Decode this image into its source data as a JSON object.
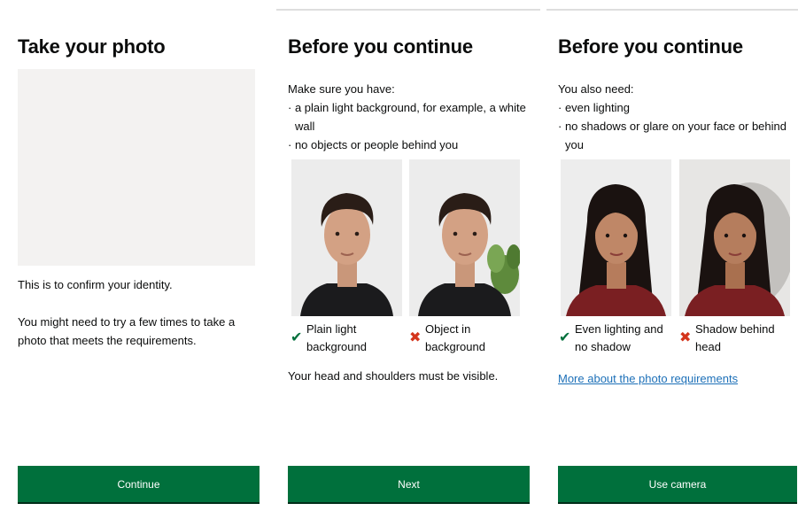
{
  "screens": [
    {
      "title": "Take your photo",
      "paragraphs": [
        "This is to confirm your identity.",
        "You might need to try a few times to take a photo that meets the requirements."
      ],
      "button": "Continue"
    },
    {
      "title": "Before you continue",
      "intro": "Make sure you have:",
      "bullets": [
        "· a plain light background, for example, a white wall",
        "· no objects or people behind you"
      ],
      "examples": [
        {
          "verdict": "tick",
          "caption": "Plain light background"
        },
        {
          "verdict": "cross",
          "caption": "Object in background"
        }
      ],
      "footer": "Your head and shoulders must be visible.",
      "button": "Next"
    },
    {
      "title": "Before you continue",
      "intro": "You also need:",
      "bullets": [
        "· even lighting",
        "· no shadows or glare on your face or behind you"
      ],
      "examples": [
        {
          "verdict": "tick",
          "caption": "Even lighting and no shadow"
        },
        {
          "verdict": "cross",
          "caption": "Shadow behind head"
        }
      ],
      "link": "More about the photo requirements",
      "button": "Use camera"
    }
  ],
  "icons": {
    "tick": "✔",
    "cross": "✖"
  },
  "colors": {
    "button": "#00703c",
    "tick": "#00703c",
    "cross": "#d4351c",
    "link": "#1d70b8"
  }
}
